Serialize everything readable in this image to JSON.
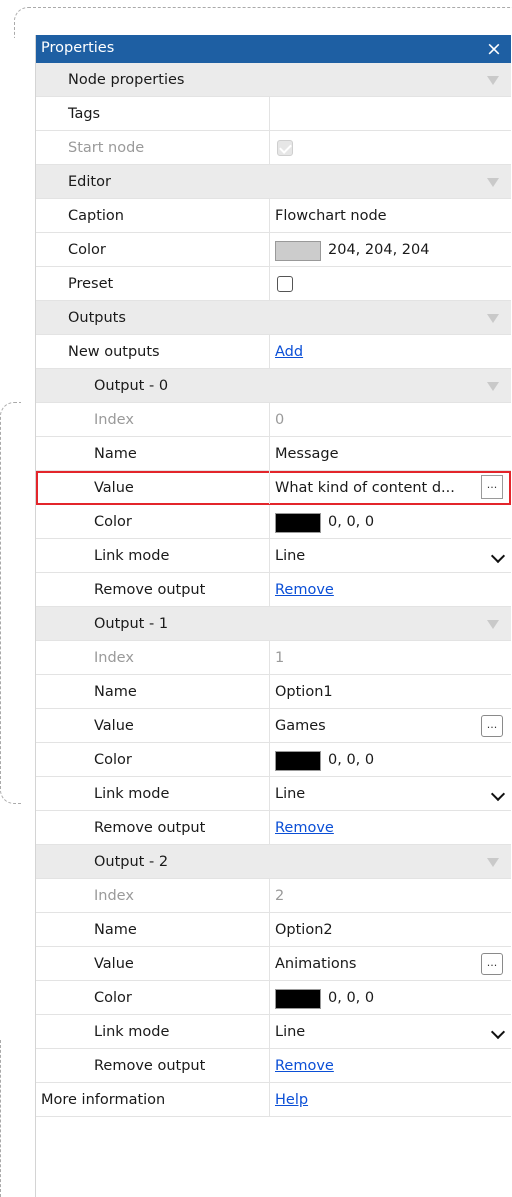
{
  "panel": {
    "title": "Properties",
    "close_label": "×"
  },
  "node_properties": {
    "header": "Node properties",
    "tags_label": "Tags",
    "tags_value": "",
    "start_node_label": "Start node",
    "start_node_checked": true
  },
  "editor": {
    "header": "Editor",
    "caption_label": "Caption",
    "caption_value": "Flowchart node",
    "color_label": "Color",
    "color_hex": "#cccccc",
    "color_value": "204, 204, 204",
    "preset_label": "Preset",
    "preset_checked": false
  },
  "outputs": {
    "header": "Outputs",
    "new_outputs_label": "New outputs",
    "add_link": "Add",
    "items": [
      {
        "header": "Output - 0",
        "index_label": "Index",
        "index_value": "0",
        "name_label": "Name",
        "name_value": "Message",
        "value_label": "Value",
        "value_value": "What kind of content d...",
        "color_label": "Color",
        "color_hex": "#000000",
        "color_value": "0, 0, 0",
        "link_mode_label": "Link mode",
        "link_mode_value": "Line",
        "remove_label": "Remove output",
        "remove_link": "Remove",
        "ellipsis": "...",
        "highlighted": true
      },
      {
        "header": "Output - 1",
        "index_label": "Index",
        "index_value": "1",
        "name_label": "Name",
        "name_value": "Option1",
        "value_label": "Value",
        "value_value": "Games",
        "color_label": "Color",
        "color_hex": "#000000",
        "color_value": "0, 0, 0",
        "link_mode_label": "Link mode",
        "link_mode_value": "Line",
        "remove_label": "Remove output",
        "remove_link": "Remove",
        "ellipsis": "..."
      },
      {
        "header": "Output - 2",
        "index_label": "Index",
        "index_value": "2",
        "name_label": "Name",
        "name_value": "Option2",
        "value_label": "Value",
        "value_value": "Animations",
        "color_label": "Color",
        "color_hex": "#000000",
        "color_value": "0, 0, 0",
        "link_mode_label": "Link mode",
        "link_mode_value": "Line",
        "remove_label": "Remove output",
        "remove_link": "Remove",
        "ellipsis": "..."
      }
    ]
  },
  "more_information": {
    "label": "More information",
    "help_link": "Help"
  },
  "colors": {
    "title_bar": "#1e5fa3",
    "highlight_border": "#e3252b",
    "link": "#0b4fd6"
  }
}
